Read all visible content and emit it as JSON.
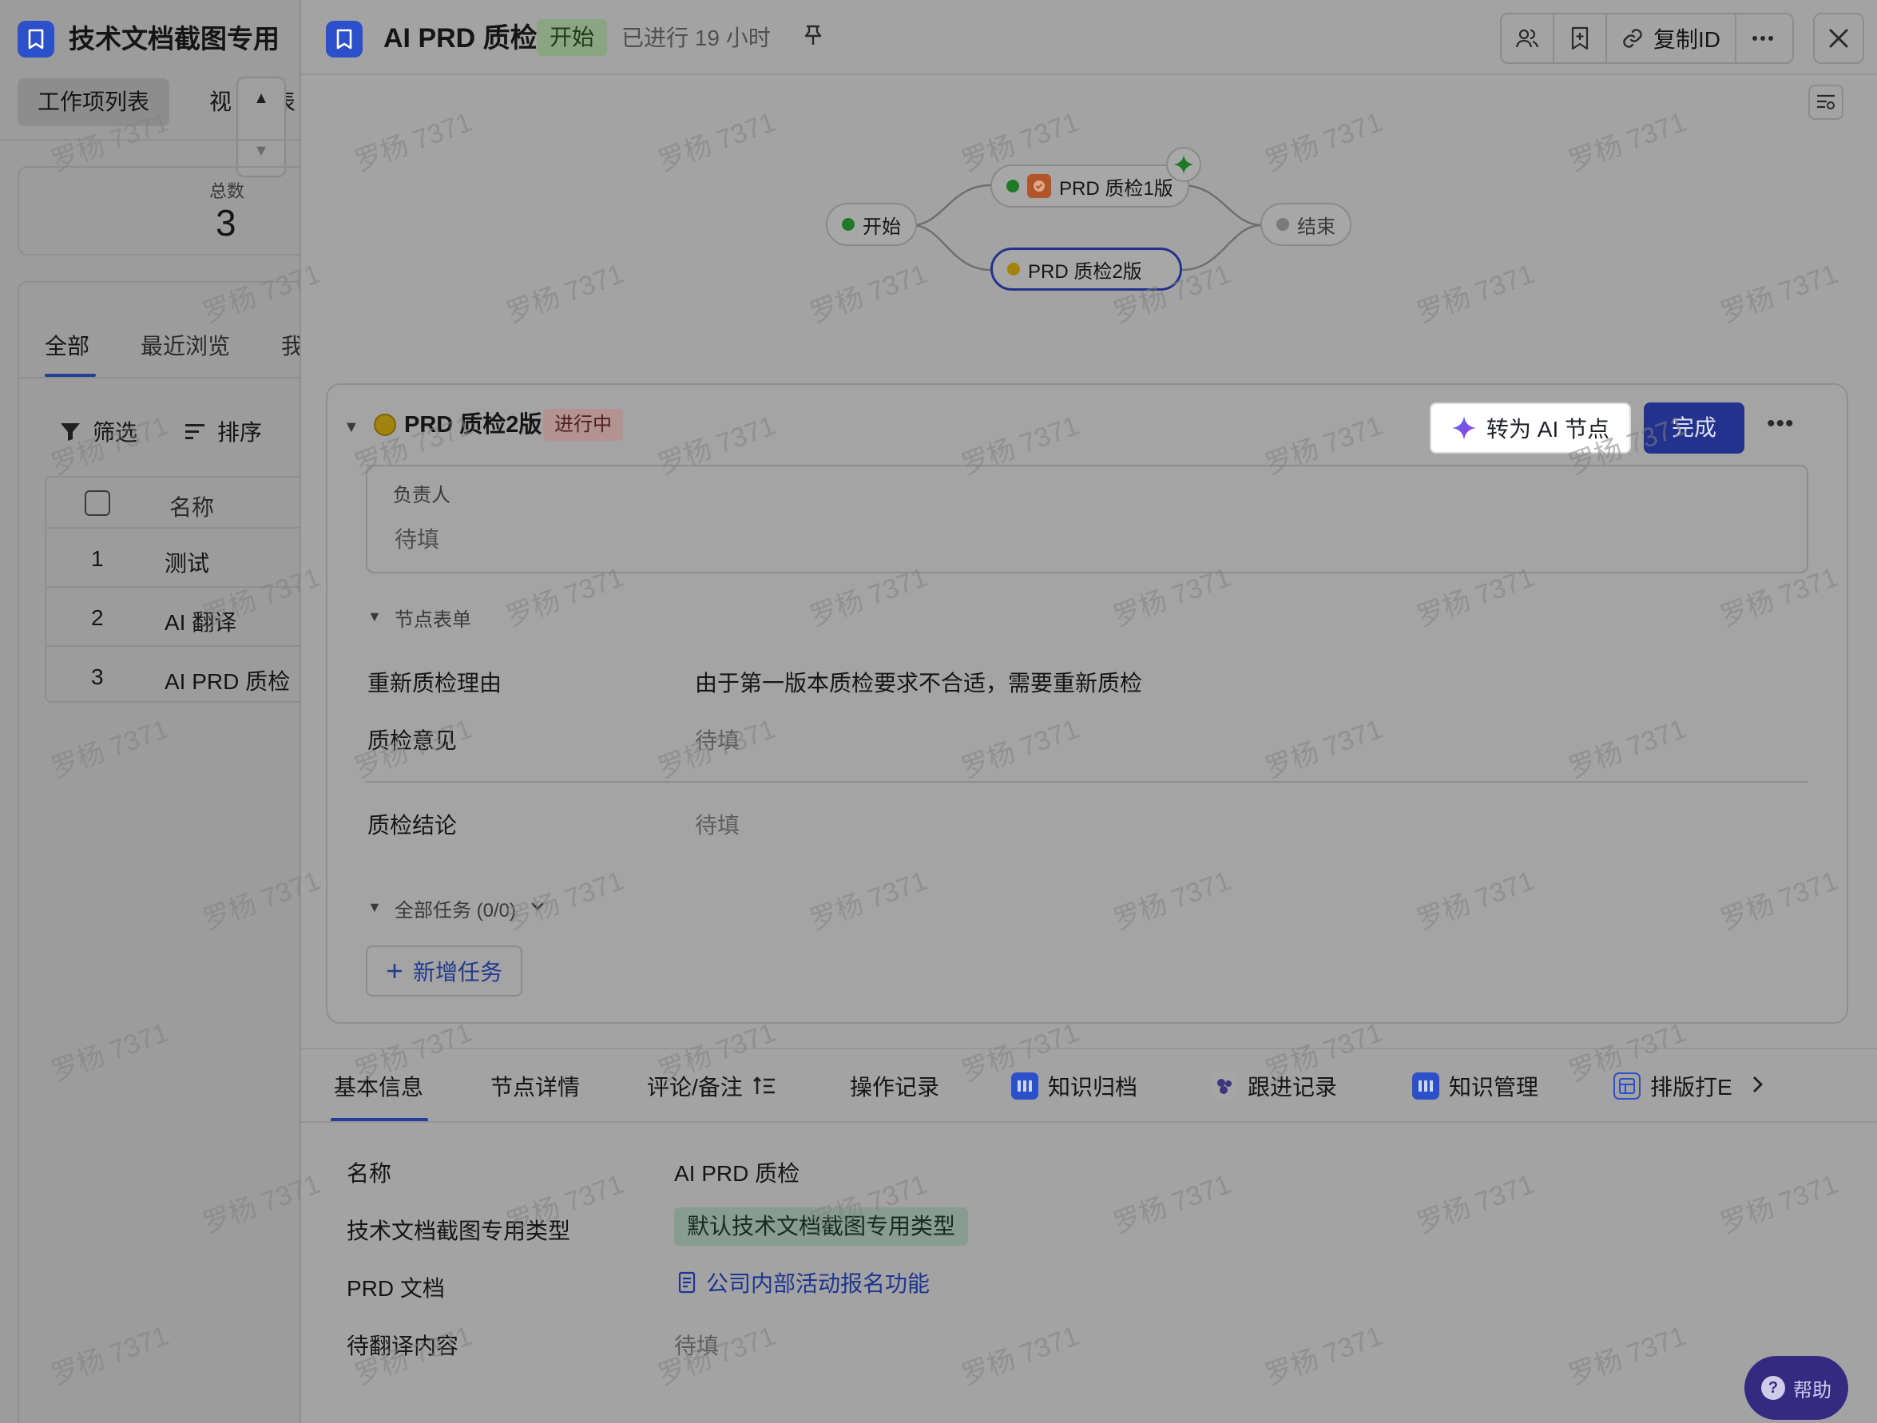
{
  "left_panel": {
    "title": "技术文档截图专用",
    "tabs": [
      "工作项列表",
      "视图",
      "表"
    ],
    "tab2_label": "视",
    "tab3_label": "表",
    "total_label": "总数",
    "total_value": "3",
    "filter_tabs": {
      "all": "全部",
      "recent": "最近浏览",
      "mine": "我"
    },
    "filter_label": "筛选",
    "sort_label": "排序",
    "table_header_name": "名称",
    "rows": [
      {
        "no": "1",
        "name": "测试"
      },
      {
        "no": "2",
        "name": "AI 翻译"
      },
      {
        "no": "3",
        "name": "AI PRD 质检"
      }
    ]
  },
  "header": {
    "title": "AI PRD 质检",
    "start_badge": "开始",
    "elapsed": "已进行 19 小时",
    "copy_id_label": "复制ID"
  },
  "flow": {
    "start": "开始",
    "node1": "PRD 质检1版",
    "node2": "PRD 质检2版",
    "end": "结束"
  },
  "node_card": {
    "title": "PRD 质检2版",
    "status": "进行中",
    "ai_button": "转为 AI 节点",
    "done_button": "完成",
    "owner_label": "负责人",
    "owner_value": "待填",
    "section_title": "节点表单",
    "fields": [
      {
        "label": "重新质检理由",
        "value": "由于第一版本质检要求不合适，需要重新质检"
      },
      {
        "label": "质检意见",
        "value": "待填"
      },
      {
        "label": "质检结论",
        "value": "待填"
      }
    ],
    "tasks_title": "全部任务 (0/0)",
    "add_task": "新增任务"
  },
  "bottom_tabs": [
    "基本信息",
    "节点详情",
    "评论/备注",
    "操作记录",
    "知识归档",
    "跟进记录",
    "知识管理",
    "排版打E"
  ],
  "basic_info": [
    {
      "label": "名称",
      "value": "AI PRD 质检"
    },
    {
      "label": "技术文档截图专用类型",
      "value": "默认技术文档截图专用类型"
    },
    {
      "label": "PRD 文档",
      "value": "公司内部活动报名功能"
    },
    {
      "label": "待翻译内容",
      "value": "待填"
    }
  ],
  "help_label": "帮助",
  "watermark": "罗杨 7371",
  "colors": {
    "brand": "#2b50c9",
    "primary_dim": "#23328c",
    "overlay_bg": "#a3a3a3"
  }
}
